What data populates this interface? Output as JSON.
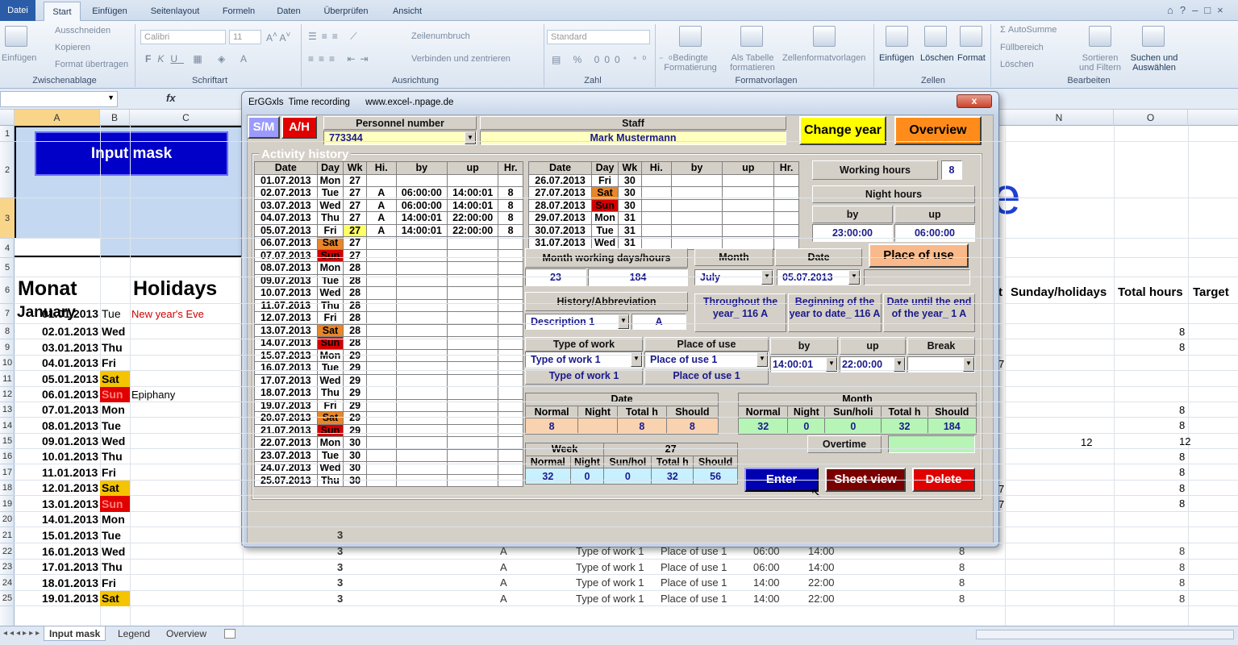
{
  "ribbon": {
    "tabs": [
      "Datei",
      "Start",
      "Einfügen",
      "Seitenlayout",
      "Formeln",
      "Daten",
      "Überprüfen",
      "Ansicht"
    ],
    "clipboard": {
      "paste": "Einfügen",
      "cut": "Ausschneiden",
      "copy": "Kopieren",
      "format_painter": "Format übertragen",
      "label": "Zwischenablage"
    },
    "font": {
      "name": "Calibri",
      "size": "11",
      "label": "Schriftart"
    },
    "alignment": {
      "wrap": "Zeilenumbruch",
      "merge": "Verbinden und zentrieren",
      "label": "Ausrichtung"
    },
    "number": {
      "format": "Standard",
      "label": "Zahl"
    },
    "styles": {
      "cond": "Bedingte Formatierung",
      "table": "Als Tabelle formatieren",
      "cell": "Zellenformatvorlagen",
      "label": "Formatvorlagen"
    },
    "cells": {
      "insert": "Einfügen",
      "delete": "Löschen",
      "format": "Format",
      "label": "Zellen"
    },
    "editing": {
      "autosum": "AutoSumme",
      "fill": "Füllbereich",
      "clear": "Löschen",
      "sort": "Sortieren und Filtern",
      "find": "Suchen und Auswählen",
      "label": "Bearbeiten"
    }
  },
  "formula_bar": {
    "fx": "fx"
  },
  "columns": [
    "A",
    "B",
    "C",
    "N",
    "O"
  ],
  "sheet": {
    "input_mask_button": "Input mask",
    "monat": "Monat",
    "holidays": "Holidays",
    "january": "January",
    "headers_right": {
      "t": "t",
      "sunday_holidays": "Sunday/holidays",
      "total_hours": "Total hours",
      "target": "Target"
    },
    "rows": [
      {
        "date": "01.01.2013",
        "day": "Tue",
        "note": "New year's Eve"
      },
      {
        "date": "02.01.2013",
        "day": "Wed"
      },
      {
        "date": "03.01.2013",
        "day": "Thu"
      },
      {
        "date": "04.01.2013",
        "day": "Fri"
      },
      {
        "date": "05.01.2013",
        "day": "Sat"
      },
      {
        "date": "06.01.2013",
        "day": "Sun",
        "note": "Epiphany"
      },
      {
        "date": "07.01.2013",
        "day": "Mon"
      },
      {
        "date": "08.01.2013",
        "day": "Tue"
      },
      {
        "date": "09.01.2013",
        "day": "Wed"
      },
      {
        "date": "10.01.2013",
        "day": "Thu"
      },
      {
        "date": "11.01.2013",
        "day": "Fri"
      },
      {
        "date": "12.01.2013",
        "day": "Sat"
      },
      {
        "date": "13.01.2013",
        "day": "Sun"
      },
      {
        "date": "14.01.2013",
        "day": "Mon"
      },
      {
        "date": "15.01.2013",
        "day": "Tue"
      },
      {
        "date": "16.01.2013",
        "day": "Wed"
      },
      {
        "date": "17.01.2013",
        "day": "Thu"
      },
      {
        "date": "18.01.2013",
        "day": "Fri"
      },
      {
        "date": "19.01.2013",
        "day": "Sat"
      }
    ],
    "bottom_rows": [
      {
        "wk": "3",
        "code": "",
        "work": "",
        "place": "",
        "by": "",
        "up": "",
        "h": "",
        "t": ""
      },
      {
        "wk": "3",
        "code": "A",
        "work": "Type of work 1",
        "place": "Place of use 1",
        "by": "06:00",
        "up": "14:00",
        "h": "8",
        "t": "8"
      },
      {
        "wk": "3",
        "code": "A",
        "work": "Type of work 1",
        "place": "Place of use 1",
        "by": "06:00",
        "up": "14:00",
        "h": "8",
        "t": "8"
      },
      {
        "wk": "3",
        "code": "A",
        "work": "Type of work 1",
        "place": "Place of use 1",
        "by": "14:00",
        "up": "22:00",
        "h": "8",
        "t": "8"
      },
      {
        "wk": "3",
        "code": "A",
        "work": "Type of work 1",
        "place": "Place of use 1",
        "by": "14:00",
        "up": "22:00",
        "h": "8",
        "t": "8"
      }
    ],
    "right_values": [
      "8",
      "8",
      "",
      "",
      "",
      "8",
      "8",
      "12",
      "8",
      "8",
      "8",
      "8"
    ],
    "n14": "12",
    "partial_7": "7",
    "big_e": "e"
  },
  "sheet_tabs": [
    "Input mask",
    "Legend",
    "Overview"
  ],
  "dialog": {
    "title": "ErGGxls  Time recording      www.excel-.npage.de",
    "close": "x",
    "sm": "S/M",
    "ah": "A/H",
    "personnel_label": "Personnel number",
    "personnel_value": "773344",
    "staff_label": "Staff",
    "staff_value": "Mark Mustermann",
    "change_year": "Change year",
    "overview": "Overview",
    "activity_history": "Activity history",
    "hist_headers": [
      "Date",
      "Day",
      "Wk",
      "Hi.",
      "by",
      "up",
      "Hr."
    ],
    "hist_left": [
      [
        "01.07.2013",
        "Mon",
        "27",
        "",
        "",
        "",
        ""
      ],
      [
        "02.07.2013",
        "Tue",
        "27",
        "A",
        "06:00:00",
        "14:00:01",
        "8"
      ],
      [
        "03.07.2013",
        "Wed",
        "27",
        "A",
        "06:00:00",
        "14:00:01",
        "8"
      ],
      [
        "04.07.2013",
        "Thu",
        "27",
        "A",
        "14:00:01",
        "22:00:00",
        "8"
      ],
      [
        "05.07.2013",
        "Fri",
        "27",
        "A",
        "14:00:01",
        "22:00:00",
        "8"
      ],
      [
        "06.07.2013",
        "Sat",
        "27",
        "",
        "",
        "",
        ""
      ],
      [
        "07.07.2013",
        "Sun",
        "27",
        "",
        "",
        "",
        ""
      ],
      [
        "08.07.2013",
        "Mon",
        "28",
        "",
        "",
        "",
        ""
      ],
      [
        "09.07.2013",
        "Tue",
        "28",
        "",
        "",
        "",
        ""
      ],
      [
        "10.07.2013",
        "Wed",
        "28",
        "",
        "",
        "",
        ""
      ],
      [
        "11.07.2013",
        "Thu",
        "28",
        "",
        "",
        "",
        ""
      ],
      [
        "12.07.2013",
        "Fri",
        "28",
        "",
        "",
        "",
        ""
      ],
      [
        "13.07.2013",
        "Sat",
        "28",
        "",
        "",
        "",
        ""
      ],
      [
        "14.07.2013",
        "Sun",
        "28",
        "",
        "",
        "",
        ""
      ],
      [
        "15.07.2013",
        "Mon",
        "29",
        "",
        "",
        "",
        ""
      ],
      [
        "16.07.2013",
        "Tue",
        "29",
        "",
        "",
        "",
        ""
      ],
      [
        "17.07.2013",
        "Wed",
        "29",
        "",
        "",
        "",
        ""
      ],
      [
        "18.07.2013",
        "Thu",
        "29",
        "",
        "",
        "",
        ""
      ],
      [
        "19.07.2013",
        "Fri",
        "29",
        "",
        "",
        "",
        ""
      ],
      [
        "20.07.2013",
        "Sat",
        "29",
        "",
        "",
        "",
        ""
      ],
      [
        "21.07.2013",
        "Sun",
        "29",
        "",
        "",
        "",
        ""
      ],
      [
        "22.07.2013",
        "Mon",
        "30",
        "",
        "",
        "",
        ""
      ],
      [
        "23.07.2013",
        "Tue",
        "30",
        "",
        "",
        "",
        ""
      ],
      [
        "24.07.2013",
        "Wed",
        "30",
        "",
        "",
        "",
        ""
      ],
      [
        "25.07.2013",
        "Thu",
        "30",
        "",
        "",
        "",
        ""
      ]
    ],
    "hist_right": [
      [
        "26.07.2013",
        "Fri",
        "30",
        "",
        "",
        "",
        ""
      ],
      [
        "27.07.2013",
        "Sat",
        "30",
        "",
        "",
        "",
        ""
      ],
      [
        "28.07.2013",
        "Sun",
        "30",
        "",
        "",
        "",
        ""
      ],
      [
        "29.07.2013",
        "Mon",
        "31",
        "",
        "",
        "",
        ""
      ],
      [
        "30.07.2013",
        "Tue",
        "31",
        "",
        "",
        "",
        ""
      ],
      [
        "31.07.2013",
        "Wed",
        "31",
        "",
        "",
        "",
        ""
      ]
    ],
    "working_hours_label": "Working hours",
    "working_hours": "8",
    "night_hours_label": "Night hours",
    "night_by_label": "by",
    "night_up_label": "up",
    "night_by": "23:00:00",
    "night_up": "06:00:00",
    "month_days_label": "Month working days/hours",
    "month_days": "23",
    "month_hours": "184",
    "month_label": "Month",
    "month_value": "July",
    "date_label": "Date",
    "date_value": "05.07.2013",
    "place_of_use_btn": "Place of use",
    "history_label": "History/Abbreviation",
    "history_value": "Description 1",
    "history_abbr": "A",
    "throughout": "Throughout the year_ 116 A",
    "beginning": "Beginning of the year to date_ 116 A",
    "until_end": "Date until the end of the year_ 1 A",
    "type_of_work_label": "Type of work",
    "type_of_work": "Type of work 1",
    "type_of_work_2": "Type of work 1",
    "place_label": "Place of use",
    "place_value": "Place of use 1",
    "place_value_2": "Place of use 1",
    "by_label": "by",
    "up_label": "up",
    "break_label": "Break",
    "by_value": "14:00:01",
    "up_value": "22:00:00",
    "break_value": "",
    "date_sum_label": "Date",
    "sum_headers": [
      "Normal",
      "Night",
      "Total h",
      "Should"
    ],
    "date_sum": [
      "8",
      "",
      "8",
      "8"
    ],
    "month_sum_label": "Month",
    "month_sum_headers": [
      "Normal",
      "Night",
      "Sun/holi",
      "Total h",
      "Should"
    ],
    "month_sum": [
      "32",
      "0",
      "0",
      "32",
      "184"
    ],
    "overtime_label": "Overtime",
    "overtime_value": "",
    "week_label": "Week",
    "week_num": "27",
    "week_headers": [
      "Normal",
      "Night",
      "Sun/hol",
      "Total h",
      "Should"
    ],
    "week_sum": [
      "32",
      "0",
      "0",
      "32",
      "56"
    ],
    "enter": "Enter",
    "sheet_view": "Sheet view",
    "delete": "Delete"
  }
}
